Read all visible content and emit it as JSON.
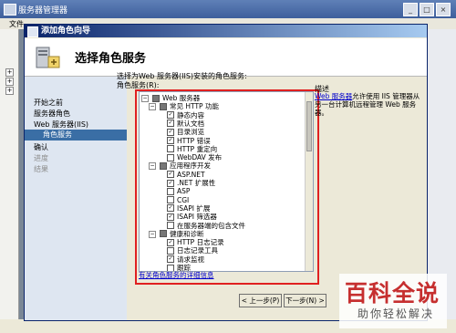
{
  "bg_window": {
    "title": "服务器管理器",
    "menu": "文件"
  },
  "dialog": {
    "title": "添加角色向导",
    "banner_title": "选择角色服务"
  },
  "wizard_nav": [
    {
      "label": "开始之前"
    },
    {
      "label": "服务器角色"
    },
    {
      "label": "Web 服务器(IIS)"
    },
    {
      "label": "角色服务"
    },
    {
      "label": "确认"
    },
    {
      "label": "进度"
    },
    {
      "label": "结果"
    }
  ],
  "content": {
    "instruction": "选择为Web 服务器(IIS)安装的角色服务:",
    "roles_label": "角色服务(R):",
    "more_info_link": "有关角色服务的详细信息",
    "description_title": "描述",
    "description_link": "Web 服务器",
    "description_text": "允许使用 IIS 管理器从另一台计算机远程管理 Web 服务器。"
  },
  "tree": [
    {
      "label": "Web 服务器",
      "level": 0,
      "checked": "partial",
      "expander": "−"
    },
    {
      "label": "常见 HTTP 功能",
      "level": 1,
      "checked": "partial",
      "expander": "−"
    },
    {
      "label": "静态内容",
      "level": 2,
      "checked": true
    },
    {
      "label": "默认文档",
      "level": 2,
      "checked": true
    },
    {
      "label": "目录浏览",
      "level": 2,
      "checked": true
    },
    {
      "label": "HTTP 错误",
      "level": 2,
      "checked": true
    },
    {
      "label": "HTTP 重定向",
      "level": 2,
      "checked": false
    },
    {
      "label": "WebDAV 发布",
      "level": 2,
      "checked": false
    },
    {
      "label": "应用程序开发",
      "level": 1,
      "checked": "partial",
      "expander": "−"
    },
    {
      "label": "ASP.NET",
      "level": 2,
      "checked": true
    },
    {
      "label": ".NET 扩展性",
      "level": 2,
      "checked": true
    },
    {
      "label": "ASP",
      "level": 2,
      "checked": false
    },
    {
      "label": "CGI",
      "level": 2,
      "checked": false
    },
    {
      "label": "ISAPI 扩展",
      "level": 2,
      "checked": true
    },
    {
      "label": "ISAPI 筛选器",
      "level": 2,
      "checked": true
    },
    {
      "label": "在服务器端的包含文件",
      "level": 2,
      "checked": false
    },
    {
      "label": "健康和诊断",
      "level": 1,
      "checked": "partial",
      "expander": "−"
    },
    {
      "label": "HTTP 日志记录",
      "level": 2,
      "checked": true
    },
    {
      "label": "日志记录工具",
      "level": 2,
      "checked": false
    },
    {
      "label": "请求监视",
      "level": 2,
      "checked": true
    },
    {
      "label": "跟踪",
      "level": 2,
      "checked": false
    }
  ],
  "buttons": {
    "back": "< 上一步(P)",
    "next": "下一步(N) >"
  },
  "watermark": {
    "big": "百科全说",
    "small": "助你轻松解决"
  }
}
